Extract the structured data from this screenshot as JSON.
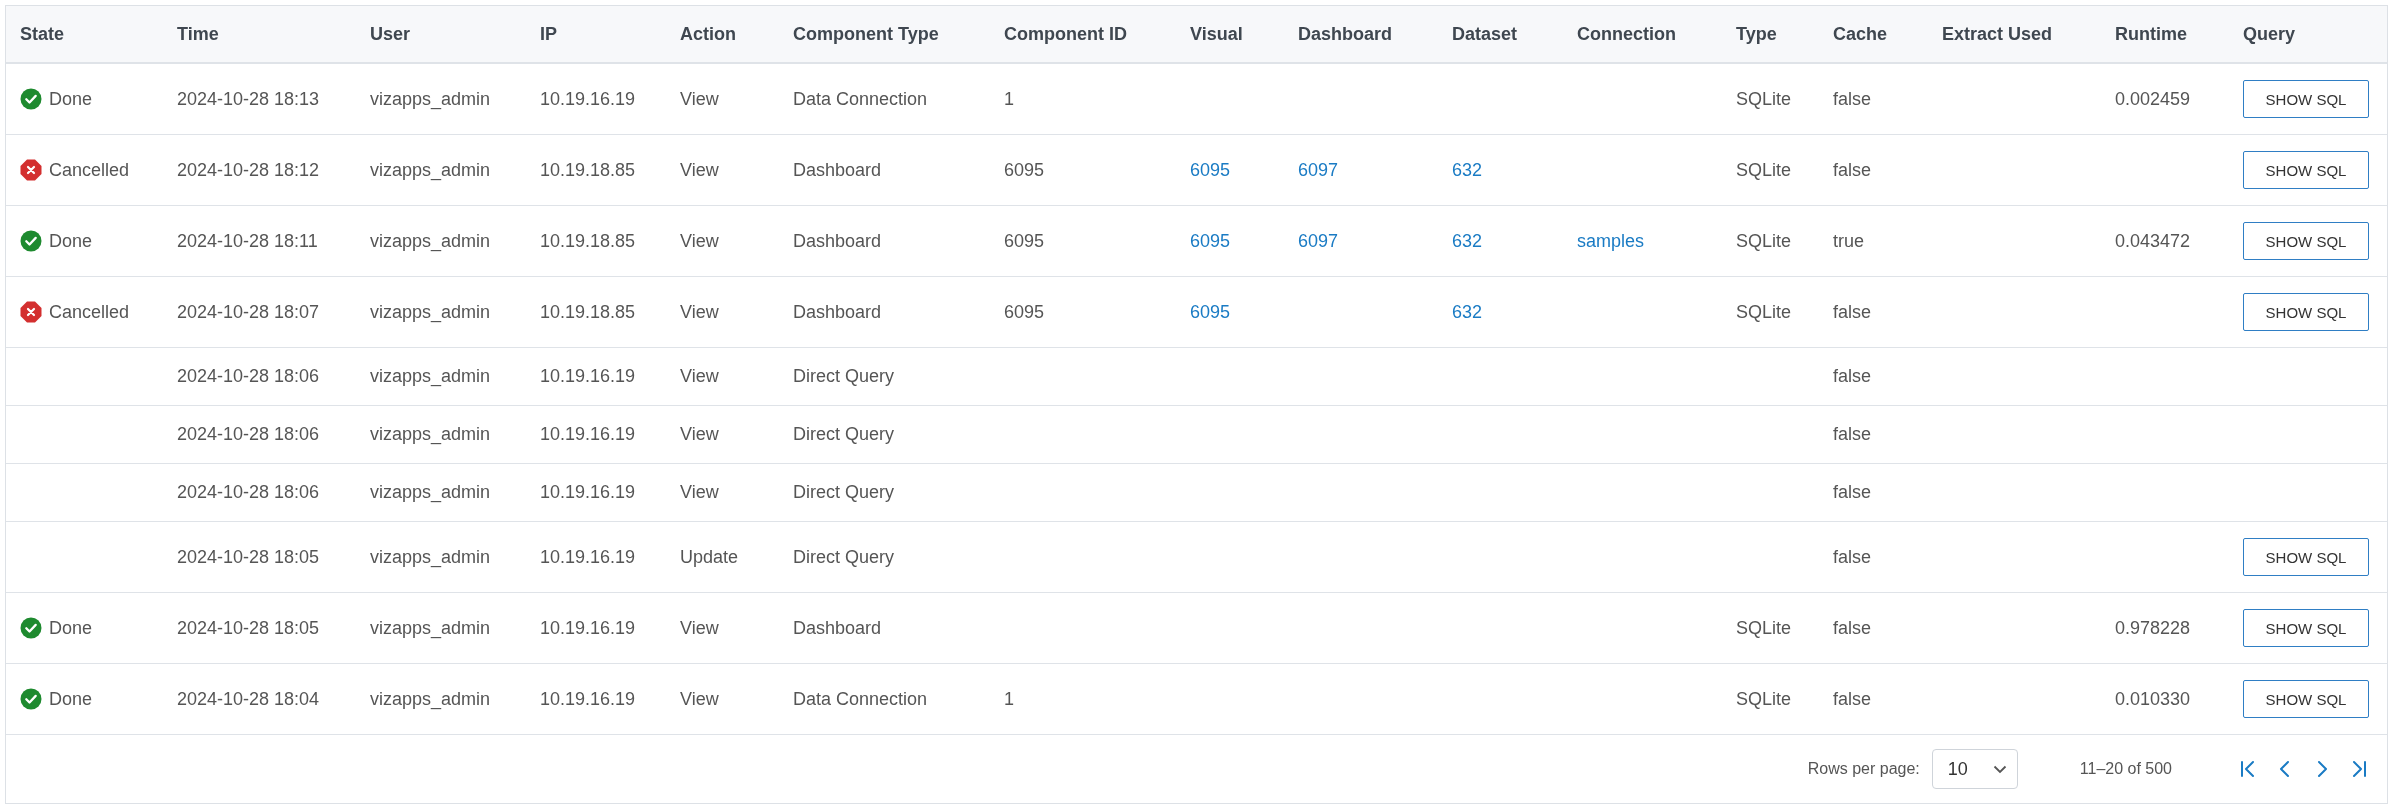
{
  "table": {
    "columns": [
      {
        "label": "State",
        "kind": "status"
      },
      {
        "label": "Time",
        "kind": "text"
      },
      {
        "label": "User",
        "kind": "text"
      },
      {
        "label": "IP",
        "kind": "text"
      },
      {
        "label": "Action",
        "kind": "text"
      },
      {
        "label": "Component Type",
        "kind": "text"
      },
      {
        "label": "Component ID",
        "kind": "text"
      },
      {
        "label": "Visual",
        "kind": "link"
      },
      {
        "label": "Dashboard",
        "kind": "link"
      },
      {
        "label": "Dataset",
        "kind": "link"
      },
      {
        "label": "Connection",
        "kind": "link"
      },
      {
        "label": "Type",
        "kind": "text"
      },
      {
        "label": "Cache",
        "kind": "text"
      },
      {
        "label": "Extract Used",
        "kind": "text"
      },
      {
        "label": "Runtime",
        "kind": "text"
      },
      {
        "label": "Query",
        "kind": "button"
      }
    ],
    "rows": [
      {
        "cells": [
          {
            "kind": "done",
            "label": "Done"
          },
          "2024-10-28 18:13",
          "vizapps_admin",
          "10.19.16.19",
          "View",
          "Data Connection",
          "1",
          null,
          null,
          null,
          null,
          "SQLite",
          "false",
          null,
          "0.002459",
          "SHOW SQL"
        ]
      },
      {
        "cells": [
          {
            "kind": "cancelled",
            "label": "Cancelled"
          },
          "2024-10-28 18:12",
          "vizapps_admin",
          "10.19.18.85",
          "View",
          "Dashboard",
          "6095",
          "6095",
          "6097",
          "632",
          null,
          "SQLite",
          "false",
          null,
          null,
          "SHOW SQL"
        ]
      },
      {
        "cells": [
          {
            "kind": "done",
            "label": "Done"
          },
          "2024-10-28 18:11",
          "vizapps_admin",
          "10.19.18.85",
          "View",
          "Dashboard",
          "6095",
          "6095",
          "6097",
          "632",
          "samples",
          "SQLite",
          "true",
          null,
          "0.043472",
          "SHOW SQL"
        ]
      },
      {
        "cells": [
          {
            "kind": "cancelled",
            "label": "Cancelled"
          },
          "2024-10-28 18:07",
          "vizapps_admin",
          "10.19.18.85",
          "View",
          "Dashboard",
          "6095",
          "6095",
          null,
          "632",
          null,
          "SQLite",
          "false",
          null,
          null,
          "SHOW SQL"
        ]
      },
      {
        "cells": [
          null,
          "2024-10-28 18:06",
          "vizapps_admin",
          "10.19.16.19",
          "View",
          "Direct Query",
          null,
          null,
          null,
          null,
          null,
          null,
          "false",
          null,
          null,
          null
        ]
      },
      {
        "cells": [
          null,
          "2024-10-28 18:06",
          "vizapps_admin",
          "10.19.16.19",
          "View",
          "Direct Query",
          null,
          null,
          null,
          null,
          null,
          null,
          "false",
          null,
          null,
          null
        ]
      },
      {
        "cells": [
          null,
          "2024-10-28 18:06",
          "vizapps_admin",
          "10.19.16.19",
          "View",
          "Direct Query",
          null,
          null,
          null,
          null,
          null,
          null,
          "false",
          null,
          null,
          null
        ]
      },
      {
        "cells": [
          null,
          "2024-10-28 18:05",
          "vizapps_admin",
          "10.19.16.19",
          "Update",
          "Direct Query",
          null,
          null,
          null,
          null,
          null,
          null,
          "false",
          null,
          null,
          "SHOW SQL"
        ]
      },
      {
        "cells": [
          {
            "kind": "done",
            "label": "Done"
          },
          "2024-10-28 18:05",
          "vizapps_admin",
          "10.19.16.19",
          "View",
          "Dashboard",
          null,
          null,
          null,
          null,
          null,
          "SQLite",
          "false",
          null,
          "0.978228",
          "SHOW SQL"
        ]
      },
      {
        "cells": [
          {
            "kind": "done",
            "label": "Done"
          },
          "2024-10-28 18:04",
          "vizapps_admin",
          "10.19.16.19",
          "View",
          "Data Connection",
          "1",
          null,
          null,
          null,
          null,
          "SQLite",
          "false",
          null,
          "0.010330",
          "SHOW SQL"
        ]
      }
    ]
  },
  "pagination": {
    "rows_per_page_label": "Rows per page:",
    "rows_per_page": "10",
    "range": "11–20 of 500"
  }
}
